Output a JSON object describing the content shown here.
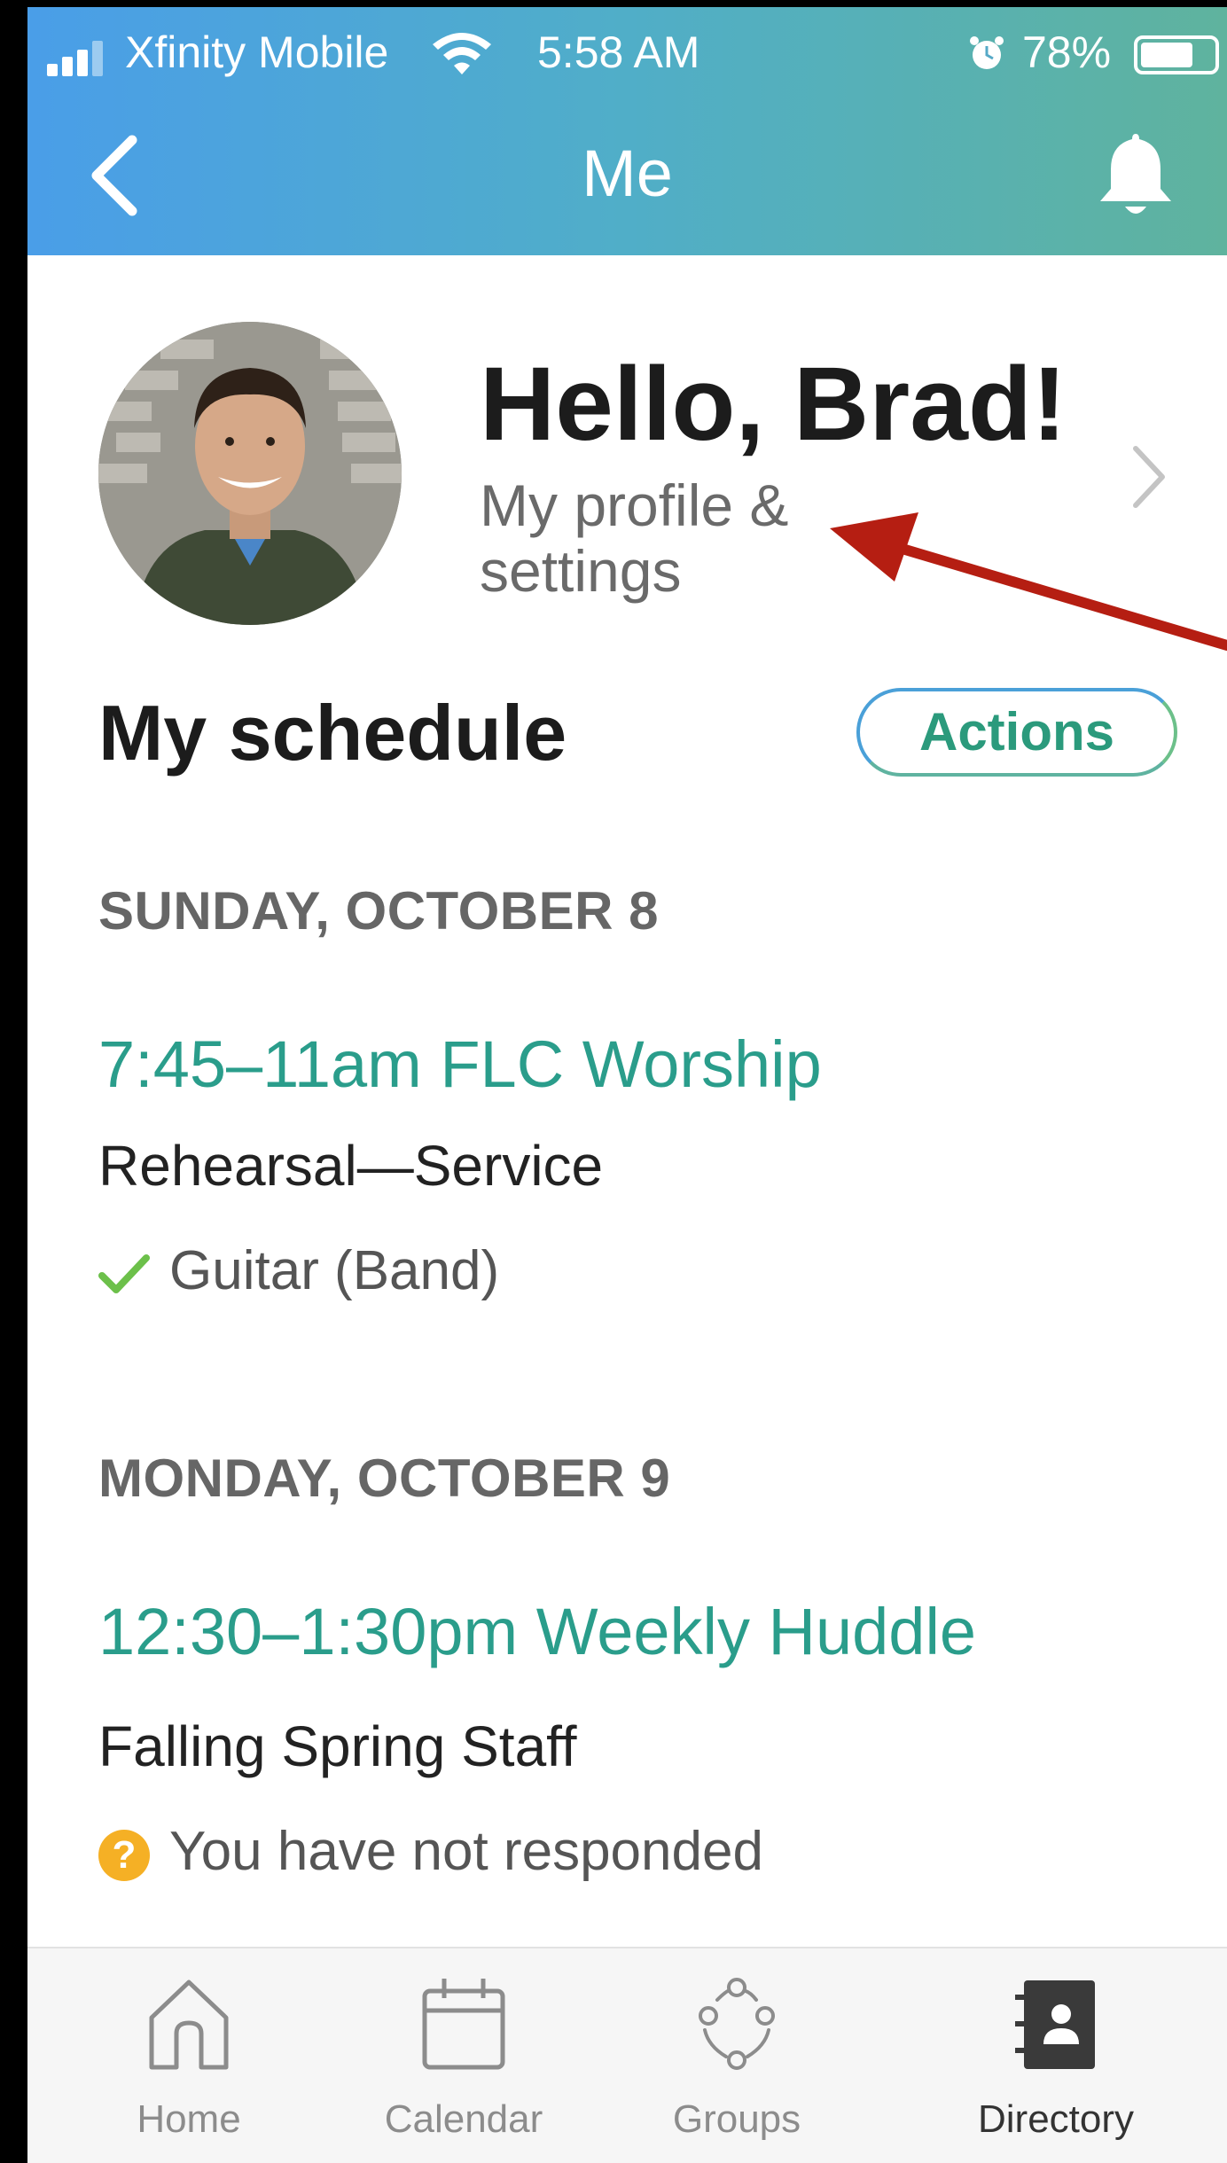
{
  "status_bar": {
    "carrier": "Xfinity Mobile",
    "time": "5:58 AM",
    "battery_percent": "78%",
    "battery_level": 0.78
  },
  "nav": {
    "title": "Me",
    "back_icon": "chevron-left-icon",
    "notification_icon": "bell-icon"
  },
  "profile": {
    "greeting": "Hello, Brad!",
    "link_text": "My profile & settings"
  },
  "schedule": {
    "title": "My schedule",
    "actions_label": "Actions",
    "days": [
      {
        "heading": "SUNDAY, OCTOBER 8",
        "events": [
          {
            "title": "7:45–11am FLC Worship",
            "subtitle": "Rehearsal—Service",
            "status": "Guitar (Band)",
            "status_icon": "check-icon"
          }
        ]
      },
      {
        "heading": "MONDAY, OCTOBER 9",
        "events": [
          {
            "title": "12:30–1:30pm Weekly Huddle",
            "subtitle": "Falling Spring Staff",
            "status": "You have not responded",
            "status_icon": "question-icon"
          }
        ]
      }
    ]
  },
  "tabbar": {
    "tabs": [
      {
        "label": "Home",
        "icon": "home-icon"
      },
      {
        "label": "Calendar",
        "icon": "calendar-icon"
      },
      {
        "label": "Groups",
        "icon": "groups-icon"
      },
      {
        "label": "Directory",
        "icon": "directory-icon"
      }
    ],
    "active": "Directory"
  },
  "colors": {
    "accent_teal": "#2a9d8b",
    "annotation_arrow": "#b51e12",
    "check_green": "#6cc04a",
    "question_orange": "#f5b025"
  }
}
